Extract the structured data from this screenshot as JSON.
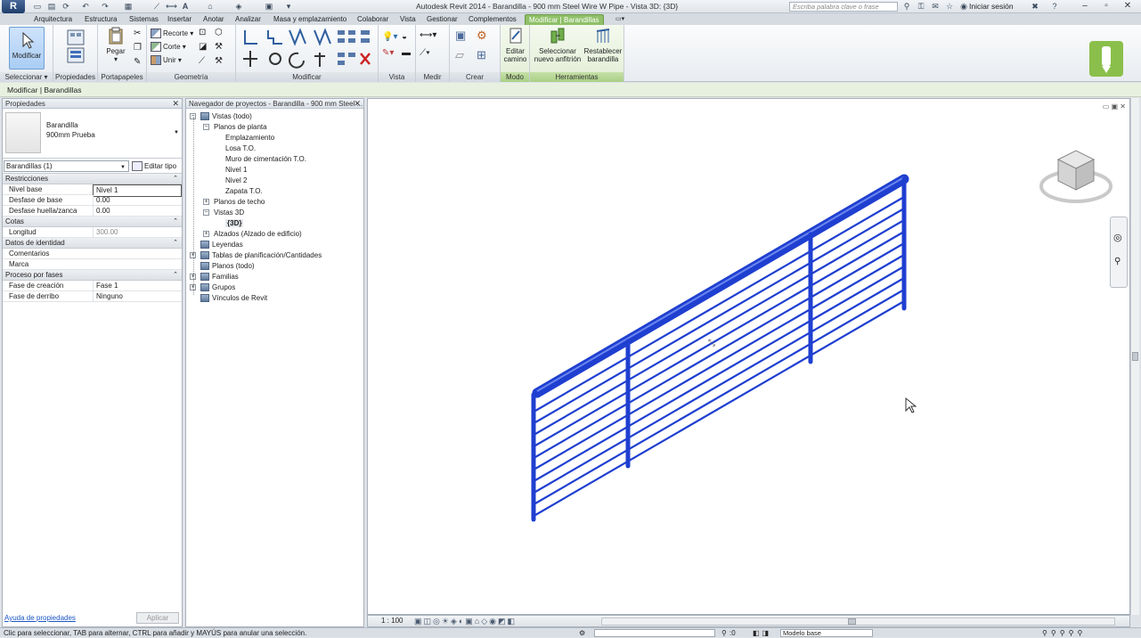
{
  "window": {
    "title": "Autodesk Revit 2014 -    Barandilla - 900 mm Steel Wire W Pipe - Vista 3D: {3D}",
    "search_placeholder": "Escriba palabra clave o frase",
    "signin": "Iniciar sesión"
  },
  "tabs": [
    "Arquitectura",
    "Estructura",
    "Sistemas",
    "Insertar",
    "Anotar",
    "Analizar",
    "Masa y emplazamiento",
    "Colaborar",
    "Vista",
    "Gestionar",
    "Complementos",
    "Modificar | Barandillas"
  ],
  "ribbon": {
    "modify_label": "Modificar",
    "paste_label": "Pegar",
    "cut_label": "Recorte",
    "cope_label": "Corte",
    "join_label": "Unir",
    "edit_path_label": "Editar camino",
    "pick_host_label": "Seleccionar nuevo anfitrión",
    "reset_label": "Restablecer barandilla",
    "panels": {
      "select": "Seleccionar",
      "properties": "Propiedades",
      "clipboard": "Portapapeles",
      "geometry": "Geometría",
      "modify": "Modificar",
      "view": "Vista",
      "measure": "Medir",
      "create": "Crear",
      "mode": "Modo",
      "tools": "Herramientas"
    }
  },
  "options_bar": "Modificar | Barandillas",
  "properties": {
    "title": "Propiedades",
    "type_family": "Barandilla",
    "type_name": "900mm Prueba",
    "instance_filter": "Barandillas (1)",
    "edit_type": "Editar tipo",
    "groups": [
      {
        "name": "Restricciones",
        "rows": [
          {
            "k": "Nivel base",
            "v": "Nivel 1"
          },
          {
            "k": "Desfase de base",
            "v": "0.00"
          },
          {
            "k": "Desfase huella/zanca",
            "v": "0.00"
          }
        ]
      },
      {
        "name": "Cotas",
        "rows": [
          {
            "k": "Longitud",
            "v": "300.00"
          }
        ]
      },
      {
        "name": "Datos de identidad",
        "rows": [
          {
            "k": "Comentarios",
            "v": ""
          },
          {
            "k": "Marca",
            "v": ""
          }
        ]
      },
      {
        "name": "Proceso por fases",
        "rows": [
          {
            "k": "Fase de creación",
            "v": "Fase 1"
          },
          {
            "k": "Fase de derribo",
            "v": "Ninguno"
          }
        ]
      }
    ],
    "help_link": "Ayuda de propiedades",
    "apply": "Aplicar"
  },
  "browser": {
    "title": "Navegador de proyectos - Barandilla - 900 mm Steel ...",
    "items": [
      "Vistas (todo)",
      "Planos de planta",
      "Emplazamiento",
      "Losa T.O.",
      "Muro de cimentación T.O.",
      "Nivel 1",
      "Nivel 2",
      "Zapata T.O.",
      "Planos de techo",
      "Vistas 3D",
      "{3D}",
      "Alzados (Alzado de edificio)",
      "Leyendas",
      "Tablas de planificación/Cantidades",
      "Planos (todo)",
      "Familias",
      "Grupos",
      "Vínculos de Revit"
    ]
  },
  "view": {
    "scale": "1 : 100",
    "railing_color": "#1f3fd0",
    "accent_color": "#8fc068"
  },
  "status": {
    "text": "Clic para seleccionar, TAB para alternar, CTRL para añadir y MAYÚS para anular una selección.",
    "zero": ":0",
    "model": "Modelo base"
  }
}
